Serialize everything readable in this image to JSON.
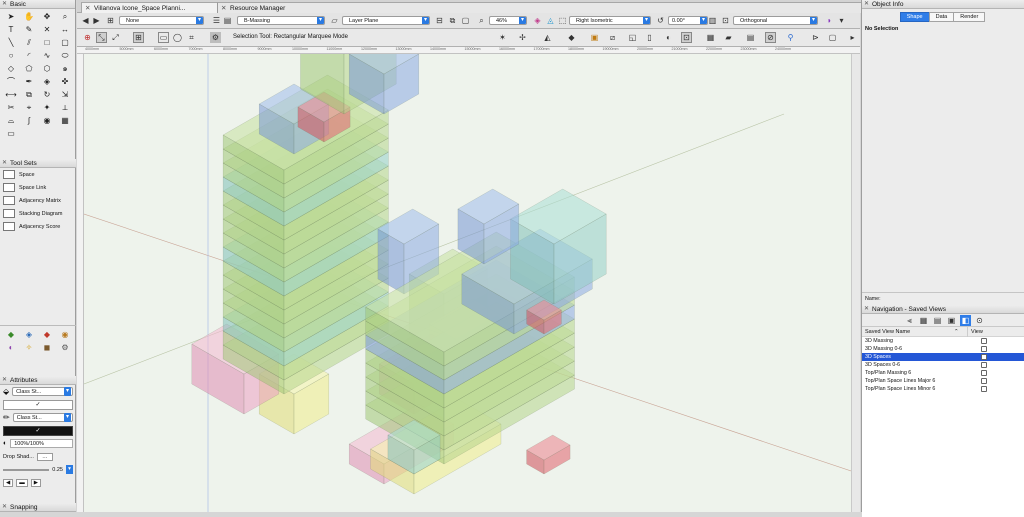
{
  "left_palette": {
    "basic_title": "Basic",
    "tool_sets_title": "Tool Sets",
    "tool_sets": [
      {
        "label": "Space"
      },
      {
        "label": "Space Link"
      },
      {
        "label": "Adjacency Matrix"
      },
      {
        "label": "Stacking Diagram"
      },
      {
        "label": "Adjacency Score"
      }
    ],
    "attributes_title": "Attributes",
    "fill_select": "Class St...",
    "pen_select": "Class St...",
    "opacity": "100%/100%",
    "drop_shadow_label": "Drop Shad...",
    "line_weight": "0.25",
    "snapping_title": "Snapping"
  },
  "tabs": {
    "document": "Villanova Icone_Space Planni...",
    "resource_manager": "Resource Manager"
  },
  "view_bar": {
    "class_select": "None",
    "layer_select": "B-Massing",
    "layer_plane_select": "Layer Plane",
    "zoom": "46%",
    "view_select": "Right Isometric",
    "rotation": "0.00°",
    "projection_select": "Orthogonal"
  },
  "mode_bar": {
    "hint": "Selection Tool: Rectangular Marquee Mode"
  },
  "ruler_ticks": [
    "4000mm",
    "5000mm",
    "6000mm",
    "7000mm",
    "8000mm",
    "9000mm",
    "10000mm",
    "11000mm",
    "12000mm",
    "13000mm",
    "14000mm",
    "15000mm",
    "16000mm",
    "17000mm",
    "18000mm",
    "19000mm",
    "20000mm",
    "21000mm",
    "22000mm",
    "23000mm",
    "24000mm"
  ],
  "object_info": {
    "title": "Object Info",
    "tabs": [
      "Shape",
      "Data",
      "Render"
    ],
    "active_tab": "Shape",
    "status": "No Selection",
    "name_label": "Name:"
  },
  "navigation": {
    "title": "Navigation - Saved Views",
    "col_name": "Saved View Name",
    "col_view": "View",
    "views": [
      {
        "name": "3D Massing",
        "selected": false
      },
      {
        "name": "3D Massing 0-6",
        "selected": false
      },
      {
        "name": "3D Spaces",
        "selected": true
      },
      {
        "name": "3D Spaces 0-6",
        "selected": false
      },
      {
        "name": "Top/Plan Massing 6",
        "selected": false
      },
      {
        "name": "Top/Plan Space Lines Major 6",
        "selected": false
      },
      {
        "name": "Top/Plan Space Lines Minor 6",
        "selected": false
      }
    ]
  },
  "colors": {
    "accent": "#2a7ae2",
    "selection": "#2457d6",
    "canvas": "#eef3ec"
  }
}
